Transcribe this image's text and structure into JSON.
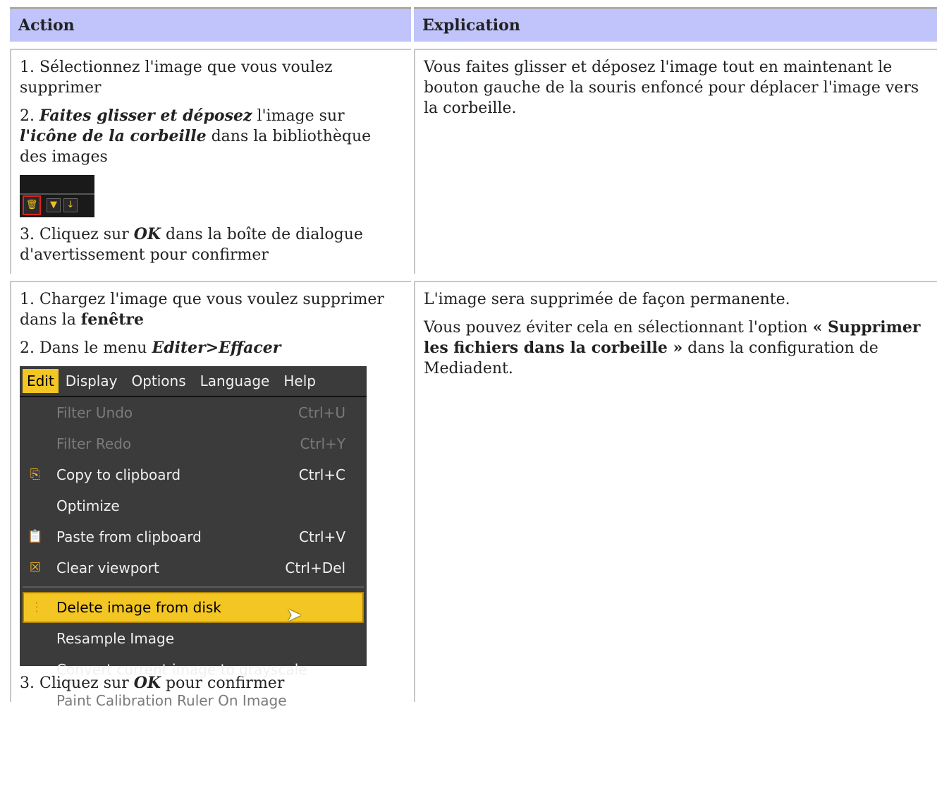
{
  "table": {
    "header": {
      "col1": "Action",
      "col2": "Explication"
    },
    "row1": {
      "step1": "1. Sélectionnez l'image que vous voulez supprimer",
      "step2_pre": "2. ",
      "step2_b1": "Faites glisser et déposez",
      "step2_mid": " l'image sur ",
      "step2_b2": "l'icône de la corbeille",
      "step2_post": " dans la bibliothèque des images",
      "step3_pre": "3. Cliquez sur ",
      "step3_b": "OK",
      "step3_post": " dans la boîte de dialogue d'avertissement pour confirmer",
      "explanation": "Vous faites glisser et déposez l'image tout en maintenant le bouton gauche de la souris enfoncé pour déplacer l'image vers la corbeille."
    },
    "row2": {
      "step1_pre": "1. Chargez l'image que vous voulez supprimer dans la ",
      "step1_b": "fenêtre",
      "step2_pre": "2. Dans le menu ",
      "step2_b": "Editer>Effacer",
      "step3_pre": "3. Cliquez sur ",
      "step3_b": "OK",
      "step3_post": " pour confirmer",
      "expl1": "L'image sera supprimée de façon permanente.",
      "expl2_pre": "Vous pouvez éviter cela en sélectionnant l'option ",
      "expl2_b": "« Supprimer les fichiers dans la corbeille »",
      "expl2_post": " dans la configuration de Mediadent."
    }
  },
  "toolbar_image": {
    "buttons": [
      {
        "icon": "trash-icon",
        "glyph": "🗑"
      },
      {
        "icon": "filter-icon",
        "glyph": "▼"
      },
      {
        "icon": "arrow-down-icon",
        "glyph": "↓"
      }
    ]
  },
  "menu": {
    "bar": [
      "Edit",
      "Display",
      "Options",
      "Language",
      "Help"
    ],
    "items": [
      {
        "label": "Filter Undo",
        "shortcut": "Ctrl+U"
      },
      {
        "label": "Filter Redo",
        "shortcut": "Ctrl+Y"
      },
      {
        "label": "Copy to clipboard",
        "shortcut": "Ctrl+C"
      },
      {
        "label": "Optimize",
        "shortcut": ""
      },
      {
        "label": "Paste from clipboard",
        "shortcut": "Ctrl+V"
      },
      {
        "label": "Clear viewport",
        "shortcut": "Ctrl+Del"
      },
      {
        "label": "Delete image from disk",
        "shortcut": ""
      },
      {
        "label": "Resample Image",
        "shortcut": ""
      },
      {
        "label": "Convert current image to grayscale",
        "shortcut": ""
      },
      {
        "label": "Paint Calibration Ruler On Image",
        "shortcut": ""
      }
    ]
  },
  "colors": {
    "header_bg": "#c0c4fb",
    "menu_bg": "#3b3b3b",
    "highlight": "#f3c623"
  }
}
